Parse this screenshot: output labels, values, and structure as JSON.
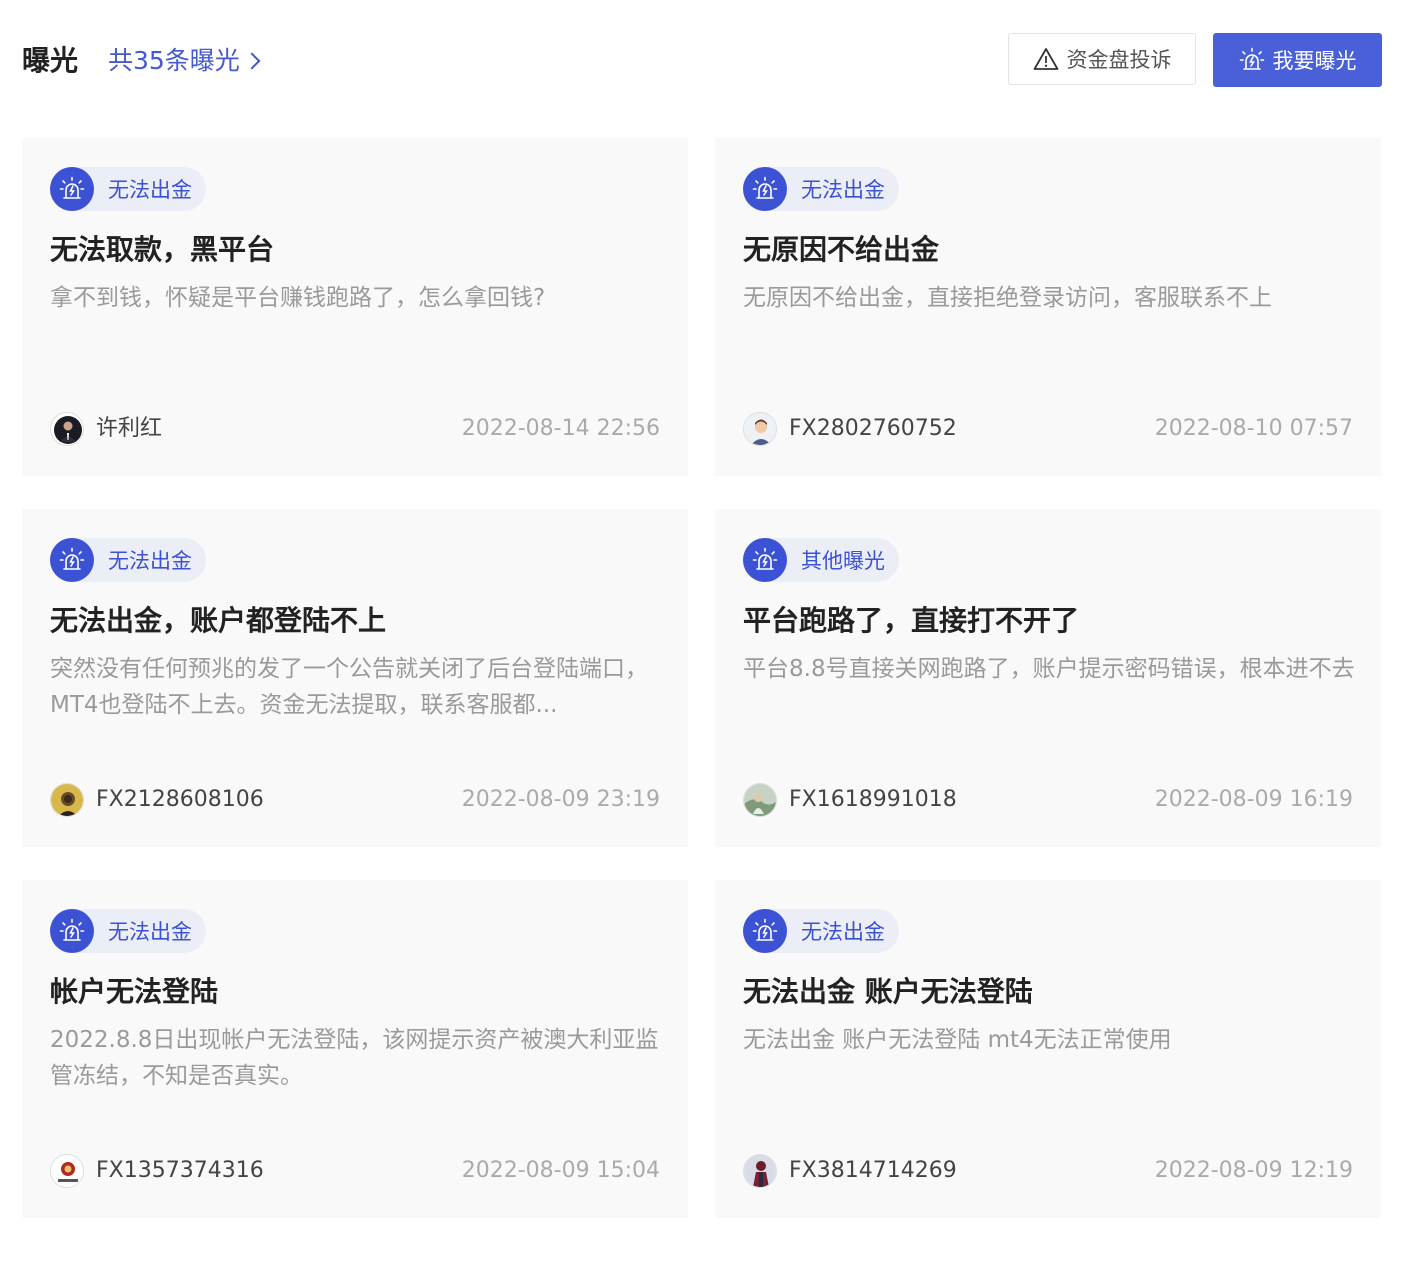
{
  "header": {
    "title": "曝光",
    "count_link": "共35条曝光",
    "complaint_button": "资金盘投诉",
    "expose_button": "我要曝光"
  },
  "colors": {
    "accent": "#4a60d8",
    "tag_bg": "#eceef7",
    "card_bg": "#f9f9fa"
  },
  "cards": [
    {
      "tag": "无法出金",
      "title": "无法取款，黑平台",
      "desc": "拿不到钱，怀疑是平台赚钱跑路了，怎么拿回钱?",
      "author": "许利红",
      "date": "2022-08-14 22:56",
      "avatar": "avatar-dark-suit"
    },
    {
      "tag": "无法出金",
      "title": "无原因不给出金",
      "desc": "无原因不给出金，直接拒绝登录访问，客服联系不上",
      "author": "FX2802760752",
      "date": "2022-08-10 07:57",
      "avatar": "avatar-default-user"
    },
    {
      "tag": "无法出金",
      "title": "无法出金，账户都登陆不上",
      "desc": "突然没有任何预兆的发了一个公告就关闭了后台登陆端口，MT4也登陆不上去。资金无法提取，联系客服都...",
      "author": "FX2128608106",
      "date": "2022-08-09 23:19",
      "avatar": "avatar-yellow-photo"
    },
    {
      "tag": "其他曝光",
      "title": "平台跑路了，直接打不开了",
      "desc": "平台8.8号直接关网跑路了，账户提示密码错误，根本进不去",
      "author": "FX1618991018",
      "date": "2022-08-09 16:19",
      "avatar": "avatar-landscape-photo"
    },
    {
      "tag": "无法出金",
      "title": "帐户无法登陆",
      "desc": "2022.8.8日出现帐户无法登陆，该网提示资产被澳大利亚监管冻结，不知是否真实。",
      "author": "FX1357374316",
      "date": "2022-08-09 15:04",
      "avatar": "avatar-red-seal"
    },
    {
      "tag": "无法出金",
      "title": "无法出金 账户无法登陆",
      "desc": "无法出金 账户无法登陆 mt4无法正常使用",
      "author": "FX3814714269",
      "date": "2022-08-09 12:19",
      "avatar": "avatar-figure-photo"
    }
  ]
}
